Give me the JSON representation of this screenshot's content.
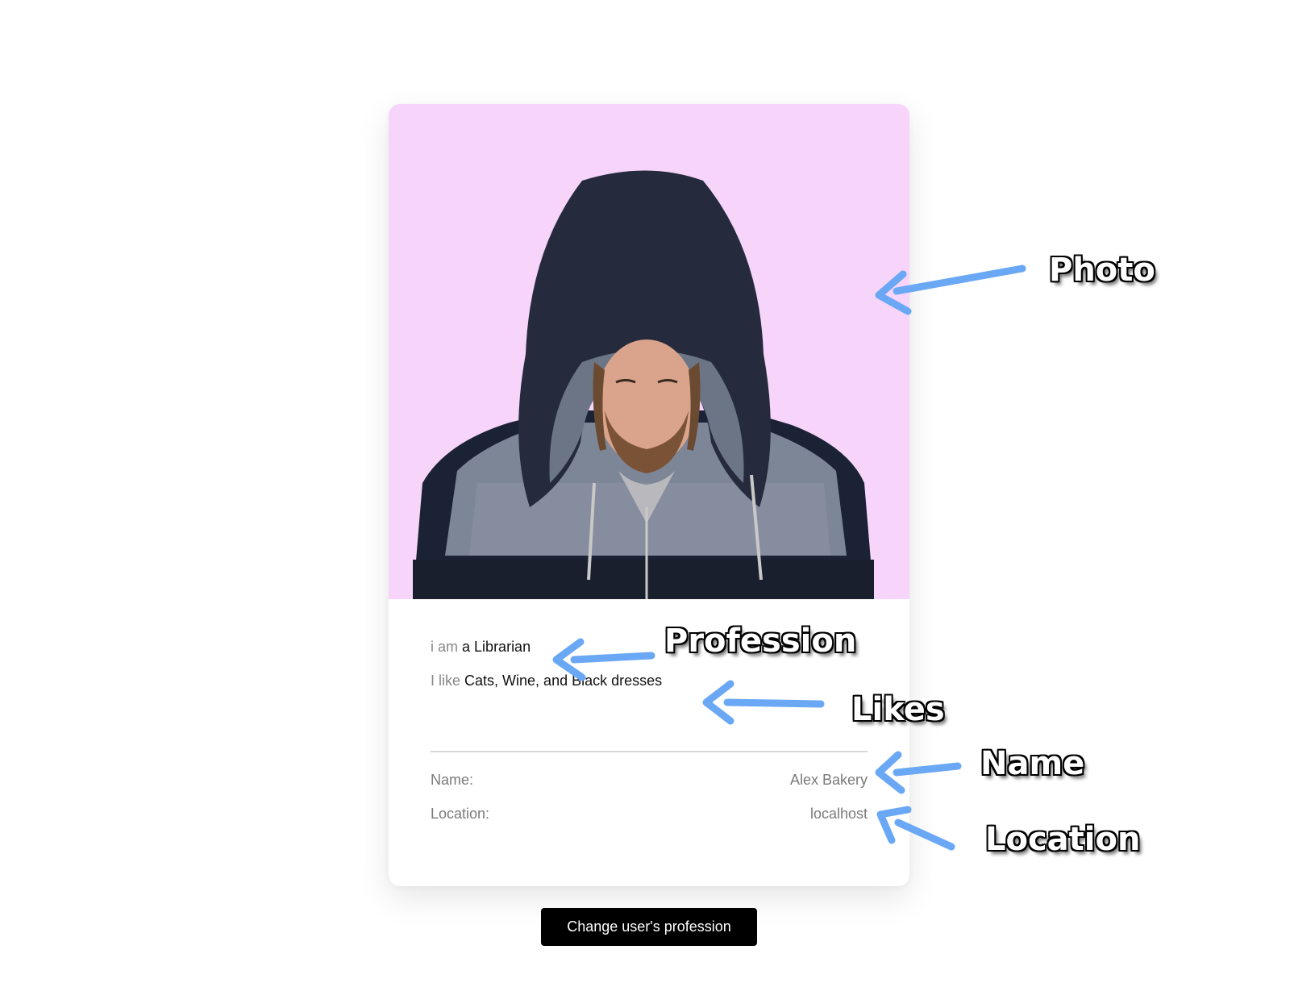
{
  "card": {
    "photo": {
      "background": "#f7d5fb"
    },
    "profession": {
      "prefix": "i am",
      "value": "a Librarian"
    },
    "likes": {
      "prefix": "I like",
      "value": "Cats, Wine, and Black dresses"
    },
    "details": [
      {
        "label": "Name:",
        "value": "Alex Bakery"
      },
      {
        "label": "Location:",
        "value": "localhost"
      }
    ]
  },
  "button": {
    "label": "Change user's profession"
  },
  "annotations": {
    "photo": "Photo",
    "profession": "Profession",
    "likes": "Likes",
    "name": "Name",
    "location": "Location",
    "arrow_color": "#6aa8f5"
  }
}
